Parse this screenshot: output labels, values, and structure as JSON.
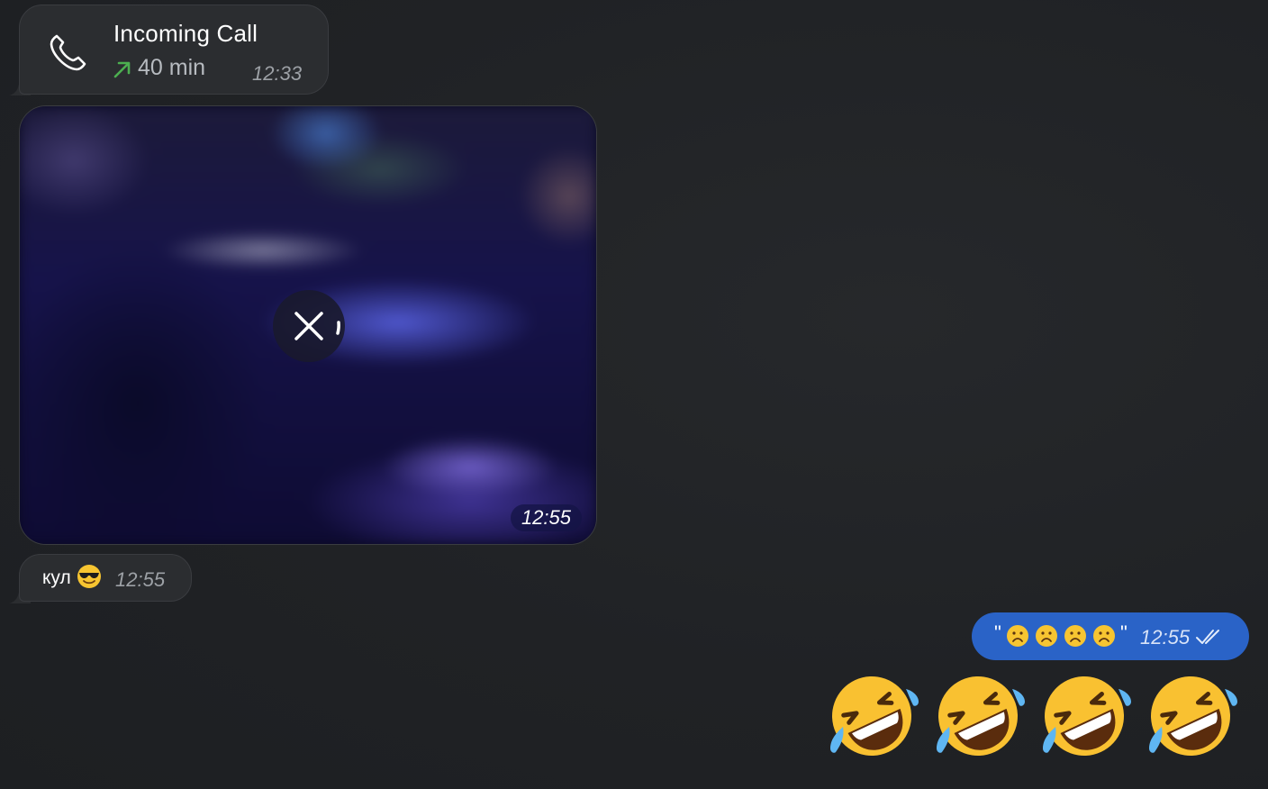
{
  "messages": {
    "call": {
      "title": "Incoming Call",
      "duration": "40 min",
      "time": "12:33",
      "icon": "phone-icon",
      "direction_icon": "arrow-up-right-icon",
      "direction_color": "#4caf50"
    },
    "media": {
      "time": "12:55",
      "overlay_icon": "close-icon"
    },
    "text_in": {
      "text": "кул",
      "emoji": "😎",
      "time": "12:55"
    },
    "text_out": {
      "quote_open": "\"",
      "quote_close": "\"",
      "emojis": [
        "☹️",
        "☹️",
        "☹️",
        "☹️"
      ],
      "time": "12:55",
      "status_icon": "double-check-icon",
      "bubble_color": "#2a63c7"
    },
    "big_emojis": [
      "🤣",
      "🤣",
      "🤣",
      "🤣"
    ]
  }
}
